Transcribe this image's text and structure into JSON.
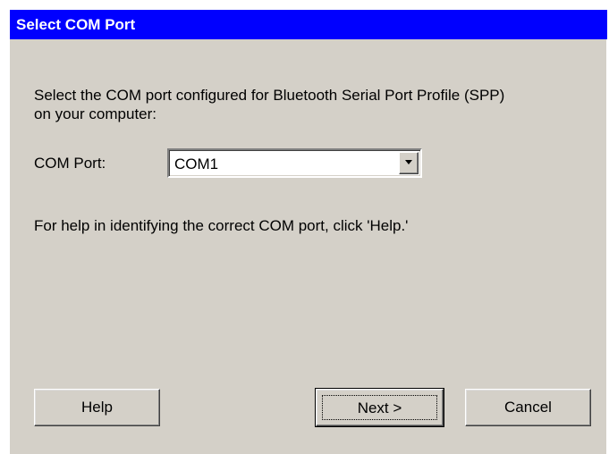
{
  "dialog": {
    "title": "Select COM Port",
    "instructions_line1": "Select the COM port configured for Bluetooth Serial Port Profile (SPP)",
    "instructions_line2": "on your computer:",
    "combo_label": "COM Port:",
    "combo_value": "COM1",
    "help_text": "For help in identifying the correct COM port, click 'Help.'"
  },
  "buttons": {
    "help": "Help",
    "next": "Next >",
    "cancel": "Cancel"
  },
  "colors": {
    "titlebar": "#0000ff",
    "dialog_bg": "#d4d0c8"
  },
  "icons": {
    "dropdown": "chevron-down-icon"
  }
}
